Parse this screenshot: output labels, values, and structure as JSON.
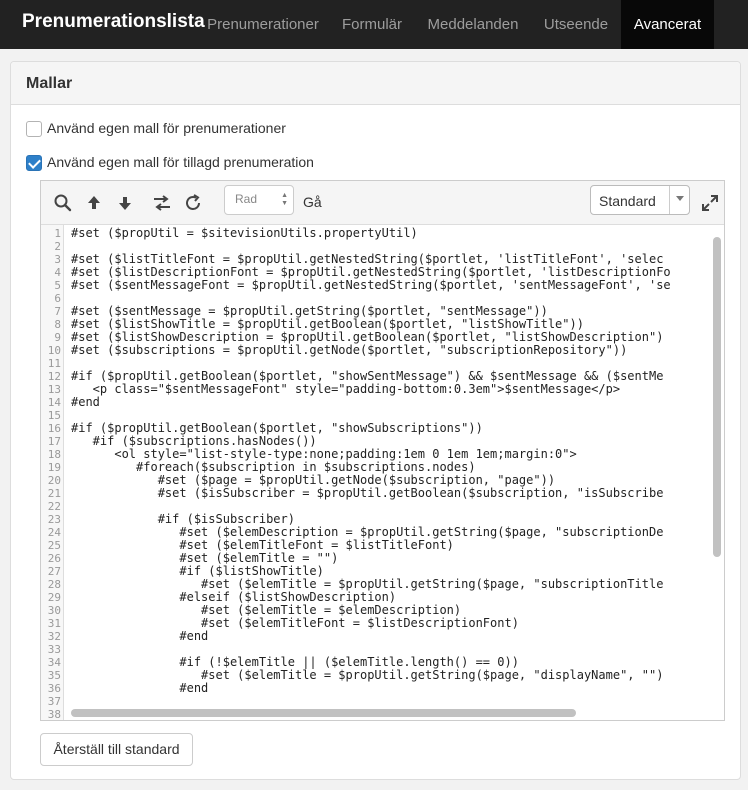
{
  "app": {
    "title": "Prenumerationslista"
  },
  "nav": {
    "tabs": [
      {
        "label": "Prenumerationer"
      },
      {
        "label": "Formulär"
      },
      {
        "label": "Meddelanden"
      },
      {
        "label": "Utseende"
      },
      {
        "label": "Avancerat",
        "active": true
      }
    ]
  },
  "panel": {
    "title": "Mallar"
  },
  "options": {
    "own_template_subscriptions": {
      "label": "Använd egen mall för prenumerationer",
      "checked": false
    },
    "own_template_added": {
      "label": "Använd egen mall för tillagd prenumeration",
      "checked": true
    }
  },
  "toolbar": {
    "icons": [
      "search-icon",
      "arrow-up-icon",
      "arrow-down-icon",
      "replace-icon",
      "refresh-icon",
      "expand-icon"
    ],
    "line_input_placeholder": "Rad",
    "go_label": "Gå",
    "theme_select_value": "Standard"
  },
  "colors": {
    "accent": "#2e80c9",
    "nav_bg": "#222222",
    "keyword": "#770088",
    "string": "#aa1111",
    "tag": "#117700",
    "attr": "#0000cc"
  },
  "code": {
    "line_numbers": [
      "1",
      "2",
      "3",
      "4",
      "5",
      "6",
      "7",
      "8",
      "9",
      "10",
      "11",
      "12",
      "13",
      "14",
      "15",
      "16",
      "17",
      "18",
      "19",
      "20",
      "21",
      "22",
      "23",
      "24",
      "25",
      "26",
      "27",
      "28",
      "29",
      "30",
      "31",
      "32",
      "33",
      "34",
      "35",
      "36",
      "37",
      "38"
    ],
    "lines": [
      "#set ($propUtil = $sitevisionUtils.propertyUtil)",
      "",
      "#set ($listTitleFont = $propUtil.getNestedString($portlet, 'listTitleFont', 'selec",
      "#set ($listDescriptionFont = $propUtil.getNestedString($portlet, 'listDescriptionFo",
      "#set ($sentMessageFont = $propUtil.getNestedString($portlet, 'sentMessageFont', 'se",
      "",
      "#set ($sentMessage = $propUtil.getString($portlet, \"sentMessage\"))",
      "#set ($listShowTitle = $propUtil.getBoolean($portlet, \"listShowTitle\"))",
      "#set ($listShowDescription = $propUtil.getBoolean($portlet, \"listShowDescription\")",
      "#set ($subscriptions = $propUtil.getNode($portlet, \"subscriptionRepository\"))",
      "",
      "#if ($propUtil.getBoolean($portlet, \"showSentMessage\") && $sentMessage && ($sentMe",
      "   <p class=\"$sentMessageFont\" style=\"padding-bottom:0.3em\">$sentMessage</p>",
      "#end",
      "",
      "#if ($propUtil.getBoolean($portlet, \"showSubscriptions\"))",
      "   #if ($subscriptions.hasNodes())",
      "      <ol style=\"list-style-type:none;padding:1em 0 1em 1em;margin:0\">",
      "         #foreach($subscription in $subscriptions.nodes)",
      "            #set ($page = $propUtil.getNode($subscription, \"page\"))",
      "            #set ($isSubscriber = $propUtil.getBoolean($subscription, \"isSubscribe",
      "",
      "            #if ($isSubscriber)",
      "               #set ($elemDescription = $propUtil.getString($page, \"subscriptionDe",
      "               #set ($elemTitleFont = $listTitleFont)",
      "               #set ($elemTitle = \"\")",
      "               #if ($listShowTitle)",
      "                  #set ($elemTitle = $propUtil.getString($page, \"subscriptionTitle",
      "               #elseif ($listShowDescription)",
      "                  #set ($elemTitle = $elemDescription)",
      "                  #set ($elemTitleFont = $listDescriptionFont)",
      "               #end",
      "",
      "               #if (!$elemTitle || ($elemTitle.length() == 0))",
      "                  #set ($elemTitle = $propUtil.getString($page, \"displayName\", \"\")",
      "               #end",
      "",
      ""
    ]
  },
  "actions": {
    "reset_label": "Återställ till standard"
  }
}
